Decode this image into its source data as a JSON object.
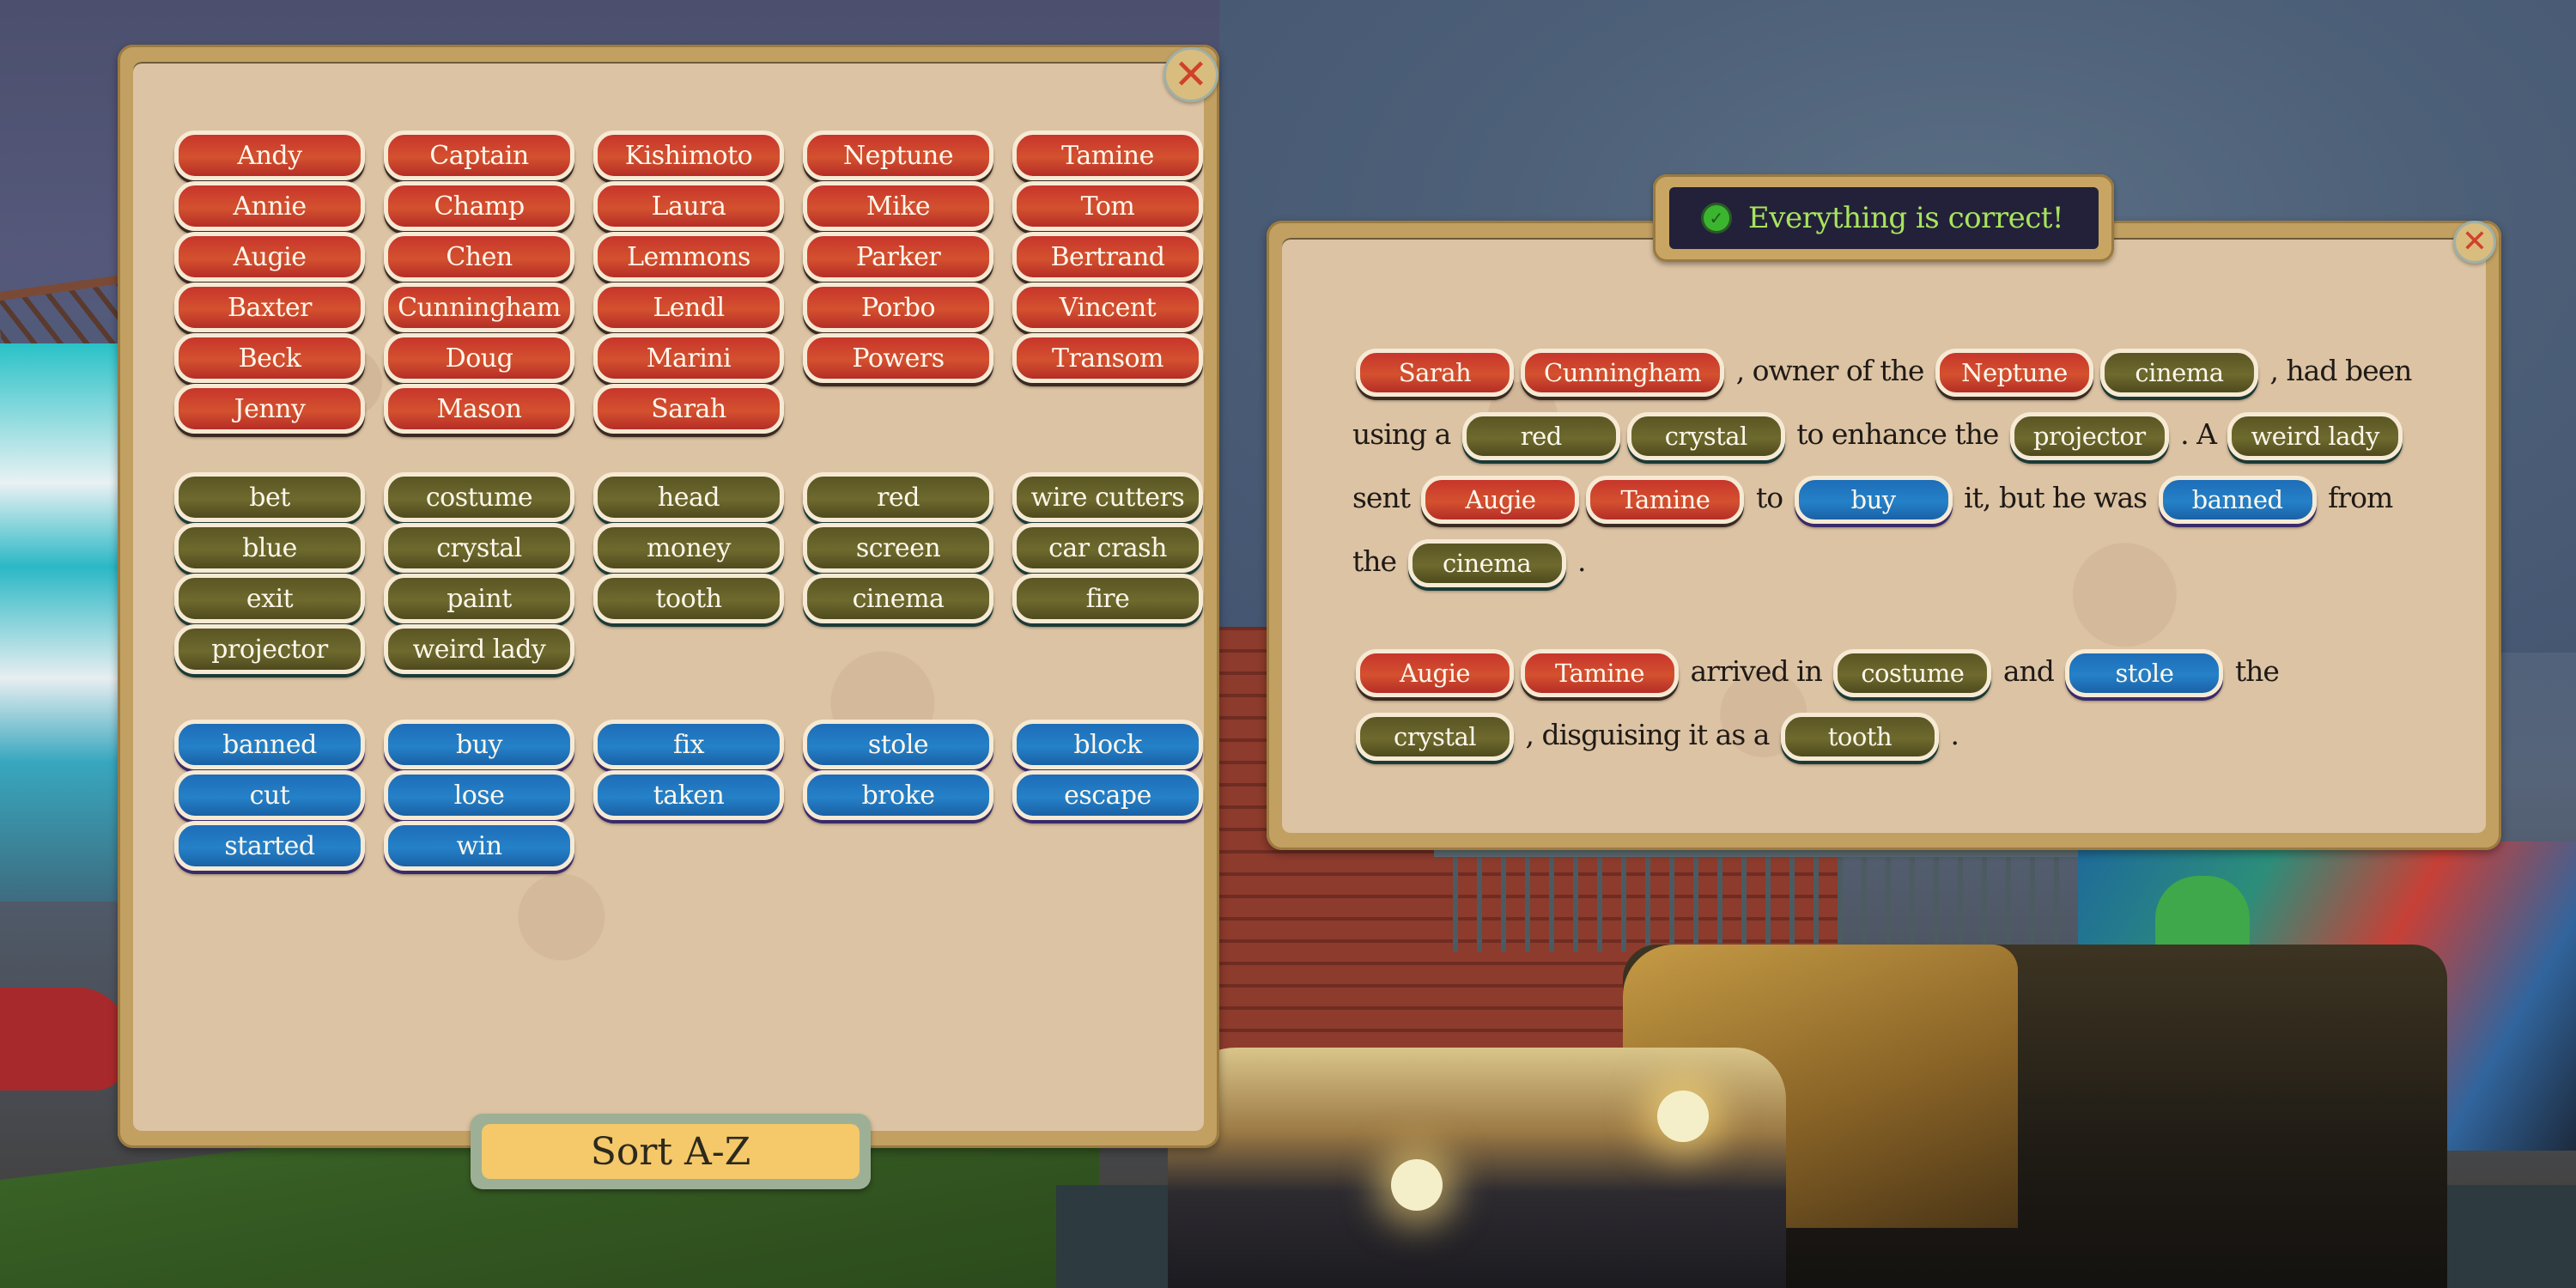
{
  "colors": {
    "name_chip": "#c7352b",
    "thing_chip": "#5f5b26",
    "action_chip": "#1d6db7",
    "banner_text": "#a8e45c",
    "sort_button": "#f5c86a"
  },
  "word_bank": {
    "close_icon": "close-icon",
    "names": [
      "Andy",
      "Captain",
      "Kishimoto",
      "Neptune",
      "Tamine",
      "Annie",
      "Champ",
      "Laura",
      "Mike",
      "Tom",
      "Augie",
      "Chen",
      "Lemmons",
      "Parker",
      "Bertrand",
      "Baxter",
      "Cunningham",
      "Lendl",
      "Porbo",
      "Vincent",
      "Beck",
      "Doug",
      "Marini",
      "Powers",
      "Transom",
      "Jenny",
      "Mason",
      "Sarah"
    ],
    "things": [
      "bet",
      "costume",
      "head",
      "red",
      "wire cutters",
      "blue",
      "crystal",
      "money",
      "screen",
      "car crash",
      "exit",
      "paint",
      "tooth",
      "cinema",
      "fire",
      "projector",
      "weird lady"
    ],
    "actions": [
      "banned",
      "buy",
      "fix",
      "stole",
      "block",
      "cut",
      "lose",
      "taken",
      "broke",
      "escape",
      "started",
      "win"
    ],
    "sort_button": "Sort A-Z"
  },
  "status_banner": {
    "icon": "check-icon",
    "text": "Everything is correct!"
  },
  "story": {
    "close_icon": "close-icon",
    "paragraph_1": [
      {
        "type": "name",
        "text": "Sarah"
      },
      {
        "type": "name",
        "text": "Cunningham"
      },
      {
        "type": "text",
        "text": ", owner of the"
      },
      {
        "type": "name",
        "text": "Neptune"
      },
      {
        "type": "thing",
        "text": "cinema"
      },
      {
        "type": "text",
        "text": ", had been using a"
      },
      {
        "type": "thing",
        "text": "red"
      },
      {
        "type": "thing",
        "text": "crystal"
      },
      {
        "type": "text",
        "text": "to enhance the"
      },
      {
        "type": "thing",
        "text": "projector"
      },
      {
        "type": "text",
        "text": ". A"
      },
      {
        "type": "thing",
        "text": "weird lady"
      },
      {
        "type": "text",
        "text": "sent"
      },
      {
        "type": "name",
        "text": "Augie"
      },
      {
        "type": "name",
        "text": "Tamine"
      },
      {
        "type": "text",
        "text": "to"
      },
      {
        "type": "action",
        "text": "buy"
      },
      {
        "type": "text",
        "text": "it, but he was"
      },
      {
        "type": "action",
        "text": "banned"
      },
      {
        "type": "text",
        "text": "from the"
      },
      {
        "type": "thing",
        "text": "cinema"
      },
      {
        "type": "text",
        "text": "."
      }
    ],
    "paragraph_2": [
      {
        "type": "name",
        "text": "Augie"
      },
      {
        "type": "name",
        "text": "Tamine"
      },
      {
        "type": "text",
        "text": "arrived in"
      },
      {
        "type": "thing",
        "text": "costume"
      },
      {
        "type": "text",
        "text": "and"
      },
      {
        "type": "action",
        "text": "stole"
      },
      {
        "type": "text",
        "text": "the"
      },
      {
        "type": "thing",
        "text": "crystal"
      },
      {
        "type": "text",
        "text": ", disguising it as a"
      },
      {
        "type": "thing",
        "text": "tooth"
      },
      {
        "type": "text",
        "text": "."
      }
    ]
  }
}
